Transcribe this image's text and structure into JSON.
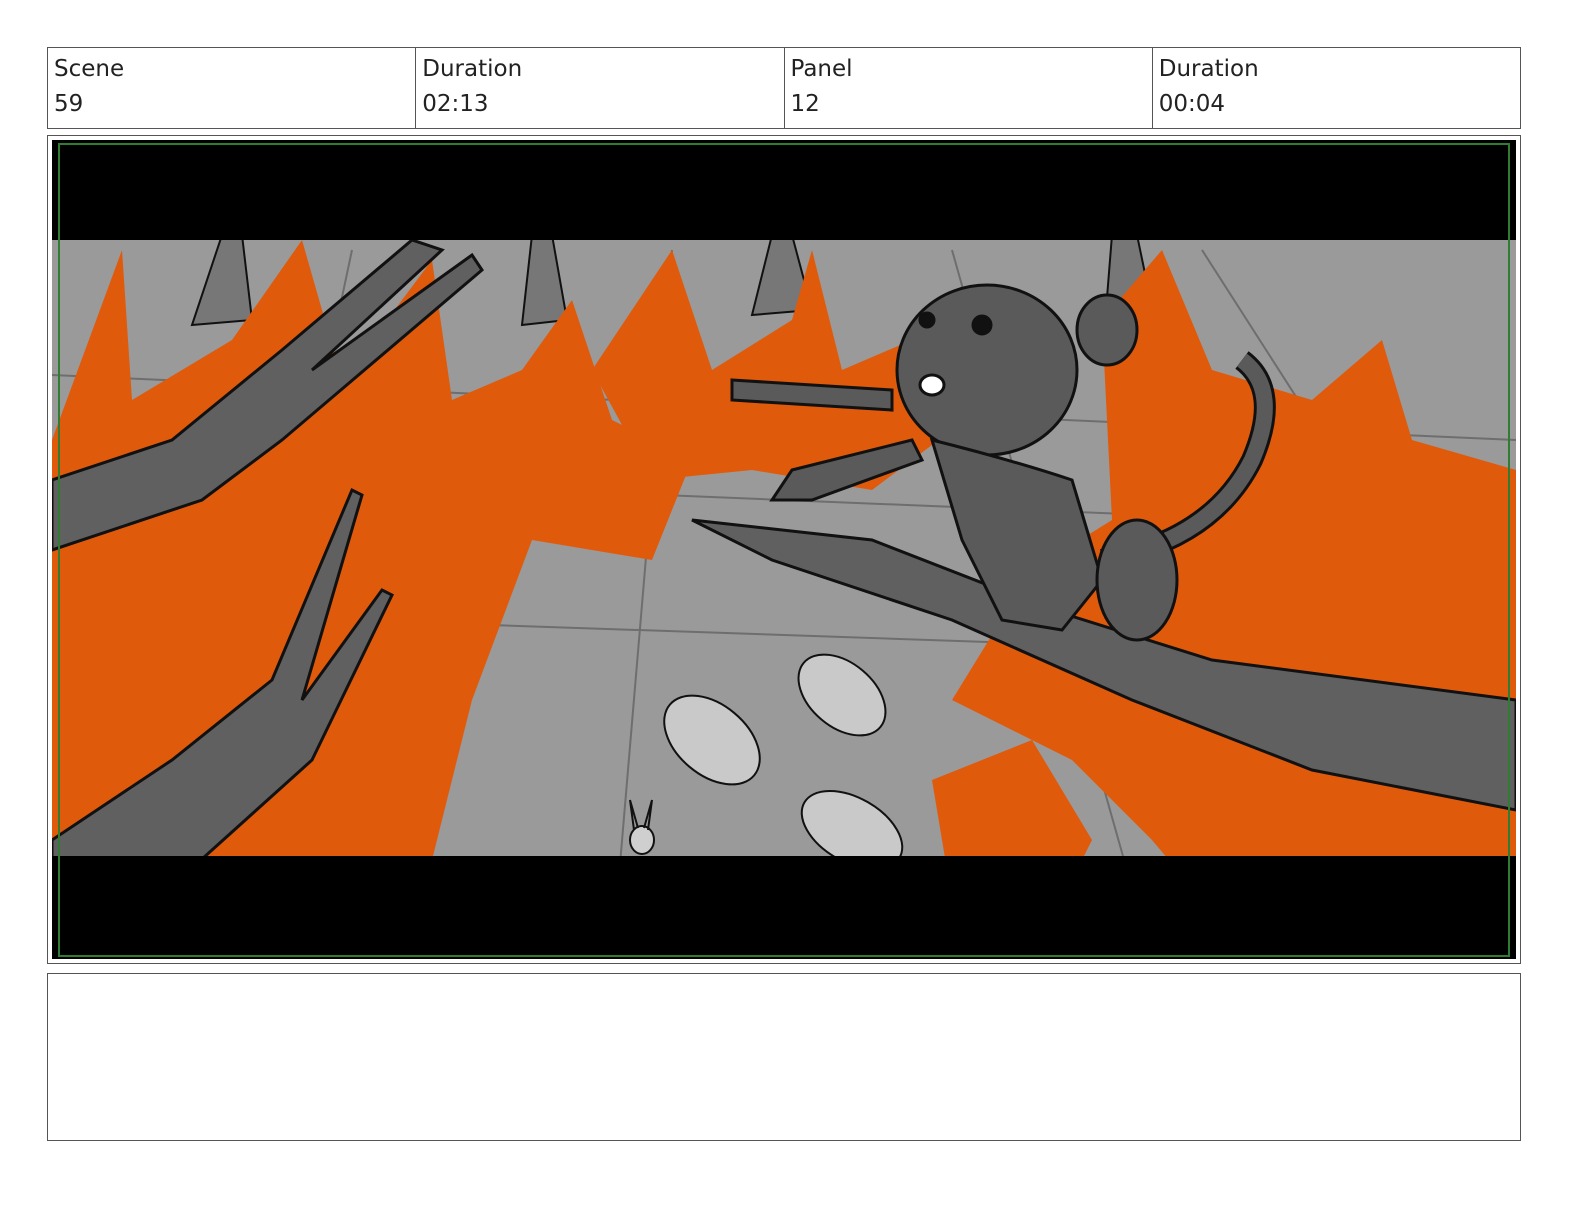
{
  "header": {
    "scene_label": "Scene",
    "scene_value": "59",
    "scene_duration_label": "Duration",
    "scene_duration_value": "02:13",
    "panel_label": "Panel",
    "panel_value": "12",
    "panel_duration_label": "Duration",
    "panel_duration_value": "00:04"
  },
  "panel": {
    "description": "",
    "colors": {
      "fire": "#e05a0c",
      "ground": "#9a9a9a",
      "branch": "#606060",
      "letterbox": "#000000",
      "safe_frame": "#2e7d32"
    }
  },
  "notes": {
    "text": ""
  }
}
